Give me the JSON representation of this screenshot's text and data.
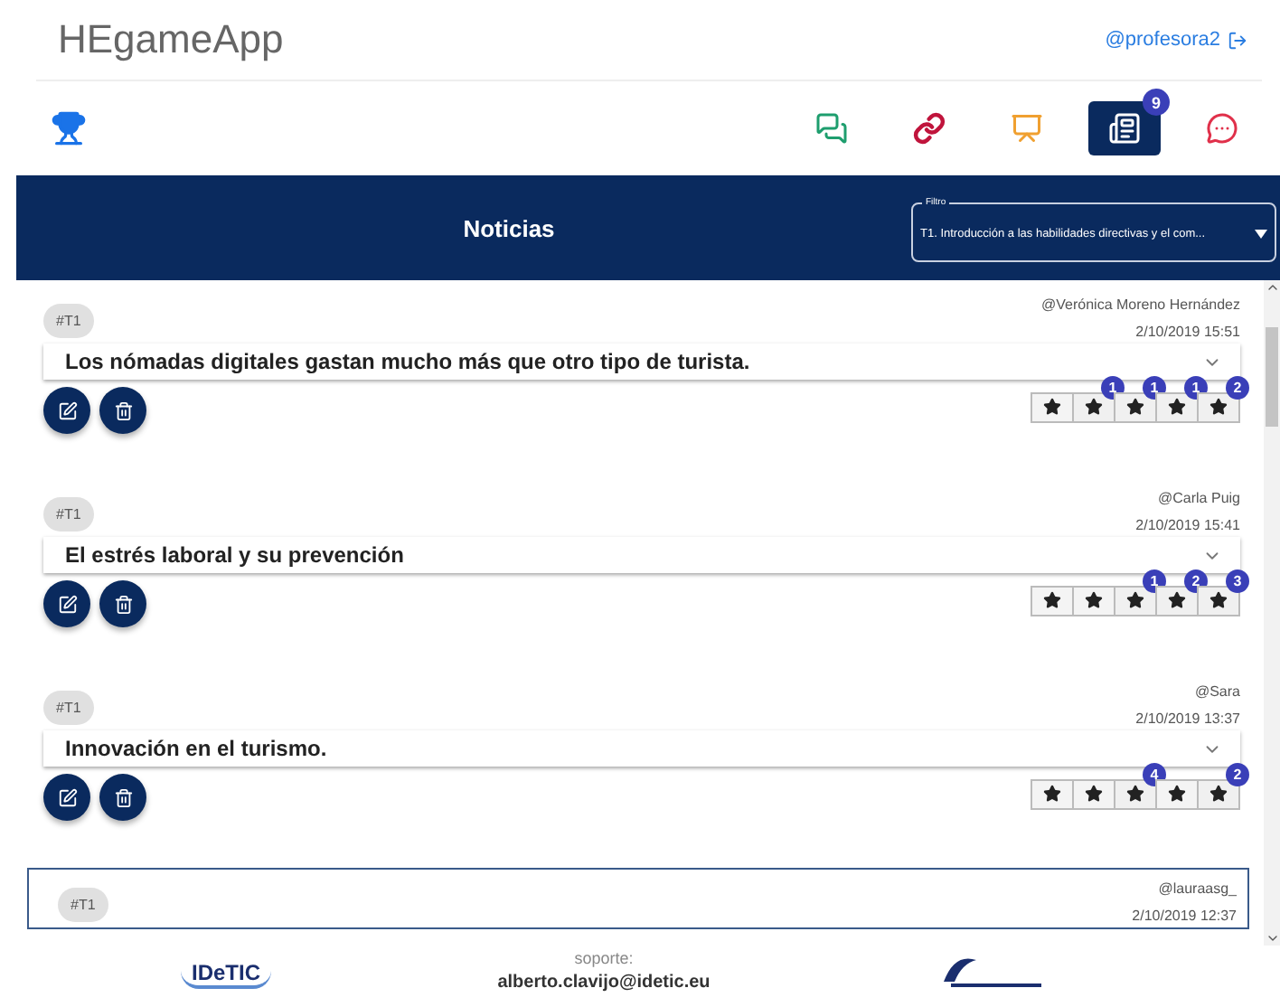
{
  "app_title": "HEgameApp",
  "user": "@profesora2",
  "nav": [
    {
      "kind": "chats",
      "color": "#1e9e6e",
      "selected": false
    },
    {
      "kind": "link",
      "color": "#c0143c",
      "selected": false
    },
    {
      "kind": "presentation",
      "color": "#f0a030",
      "selected": false
    },
    {
      "kind": "news",
      "color": "#0a2a5e",
      "selected": true,
      "badge": "9"
    },
    {
      "kind": "message",
      "color": "#e0304a",
      "selected": false
    }
  ],
  "section_title": "Noticias",
  "filter": {
    "label": "Filtro",
    "value": "T1. Introducción a las habilidades directivas y el com..."
  },
  "posts": [
    {
      "tag": "#T1",
      "author": "@Verónica Moreno Hernández",
      "date": "2/10/2019 15:51",
      "title": "Los nómadas digitales gastan mucho más que otro tipo de turista.",
      "selected": false,
      "stars": [
        {
          "kind": "plain"
        },
        {
          "kind": "counted",
          "badge": "1"
        },
        {
          "kind": "counted",
          "badge": "1"
        },
        {
          "kind": "counted",
          "badge": "1"
        },
        {
          "kind": "counted",
          "badge": "2"
        }
      ]
    },
    {
      "tag": "#T1",
      "author": "@Carla Puig",
      "date": "2/10/2019 15:41",
      "title": "El estrés laboral y su prevención",
      "selected": false,
      "stars": [
        {
          "kind": "plain"
        },
        {
          "kind": "plain"
        },
        {
          "kind": "counted",
          "badge": "1"
        },
        {
          "kind": "counted",
          "badge": "2"
        },
        {
          "kind": "counted",
          "badge": "3"
        }
      ]
    },
    {
      "tag": "#T1",
      "author": "@Sara",
      "date": "2/10/2019 13:37",
      "title": "Innovación en el turismo.",
      "selected": false,
      "stars": [
        {
          "kind": "plain"
        },
        {
          "kind": "plain"
        },
        {
          "kind": "counted",
          "badge": "4"
        },
        {
          "kind": "plain"
        },
        {
          "kind": "counted",
          "badge": "2"
        }
      ]
    },
    {
      "tag": "#T1",
      "author": "@lauraasg_",
      "date": "2/10/2019 12:37",
      "selected": true
    }
  ],
  "footer": {
    "logo_text": "IDeTIC",
    "support_label": "soporte:",
    "support_email": "alberto.clavijo@idetic.eu"
  }
}
